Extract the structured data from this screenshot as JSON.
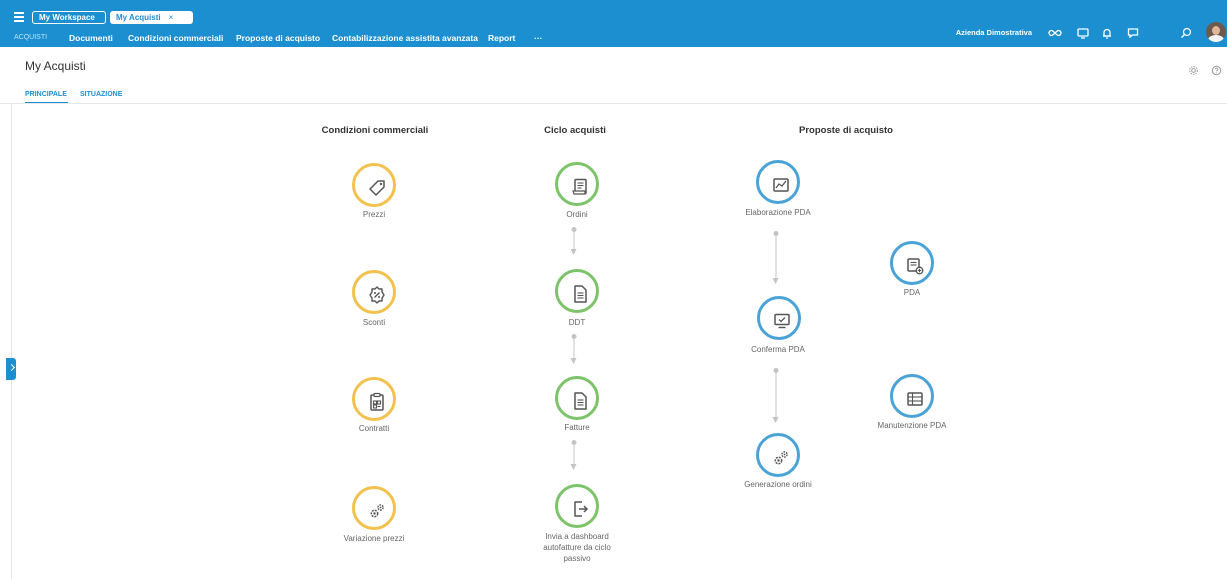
{
  "topbar": {
    "workspace_tab": "My Workspace",
    "active_tab": "My Acquisti",
    "active_tab_close": "×",
    "section": "ACQUISTI",
    "nav": [
      "Documenti",
      "Condizioni commerciali",
      "Proposte di acquisto",
      "Contabilizzazione assistita avanzata",
      "Report",
      "···"
    ],
    "company": "Azienda Dimostrativa",
    "icons": [
      "infinity-icon",
      "monitor-icon",
      "bell-icon",
      "chat-icon",
      "search-icon"
    ]
  },
  "page": {
    "title": "My Acquisti",
    "tabs": [
      "PRINCIPALE",
      "SITUAZIONE"
    ],
    "active_tab": "PRINCIPALE"
  },
  "columns": [
    {
      "title": "Condizioni commerciali",
      "items": [
        "Prezzi",
        "Sconti",
        "Contratti",
        "Variazione prezzi"
      ]
    },
    {
      "title": "Ciclo acquisti",
      "items": [
        "Ordini",
        "DDT",
        "Fatture",
        "Invia a dashboard autofatture da ciclo passivo"
      ]
    },
    {
      "title": "Proposte di acquisto",
      "items": [
        "Elaborazione PDA",
        "Conferma PDA",
        "Generazione ordini",
        "PDA",
        "Manutenzione PDA"
      ]
    }
  ],
  "colors": {
    "brand": "#1b8fd0",
    "yellow": "#f2c14e",
    "green": "#7cc36a",
    "blue": "#4aa3d6"
  }
}
